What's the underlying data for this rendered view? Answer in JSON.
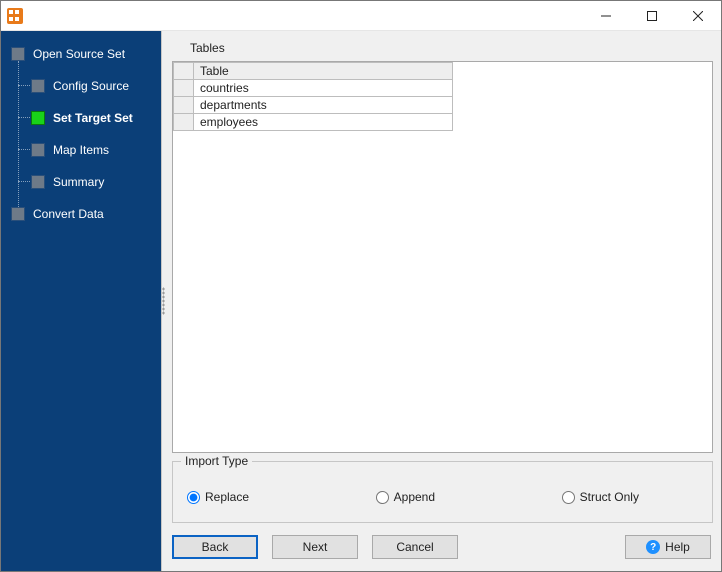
{
  "window": {
    "title": ""
  },
  "sidebar": {
    "items": [
      {
        "label": "Open Source Set",
        "level": 0,
        "active": false
      },
      {
        "label": "Config Source",
        "level": 1,
        "active": false
      },
      {
        "label": "Set Target Set",
        "level": 1,
        "active": true
      },
      {
        "label": "Map Items",
        "level": 1,
        "active": false
      },
      {
        "label": "Summary",
        "level": 1,
        "active": false
      },
      {
        "label": "Convert Data",
        "level": 0,
        "active": false
      }
    ]
  },
  "tables": {
    "section_label": "Tables",
    "header": "Table",
    "rows": [
      "countries",
      "departments",
      "employees"
    ]
  },
  "import_type": {
    "group_label": "Import Type",
    "options": [
      {
        "label": "Replace",
        "checked": true
      },
      {
        "label": "Append",
        "checked": false
      },
      {
        "label": "Struct Only",
        "checked": false
      }
    ]
  },
  "buttons": {
    "back": "Back",
    "next": "Next",
    "cancel": "Cancel",
    "help": "Help"
  }
}
